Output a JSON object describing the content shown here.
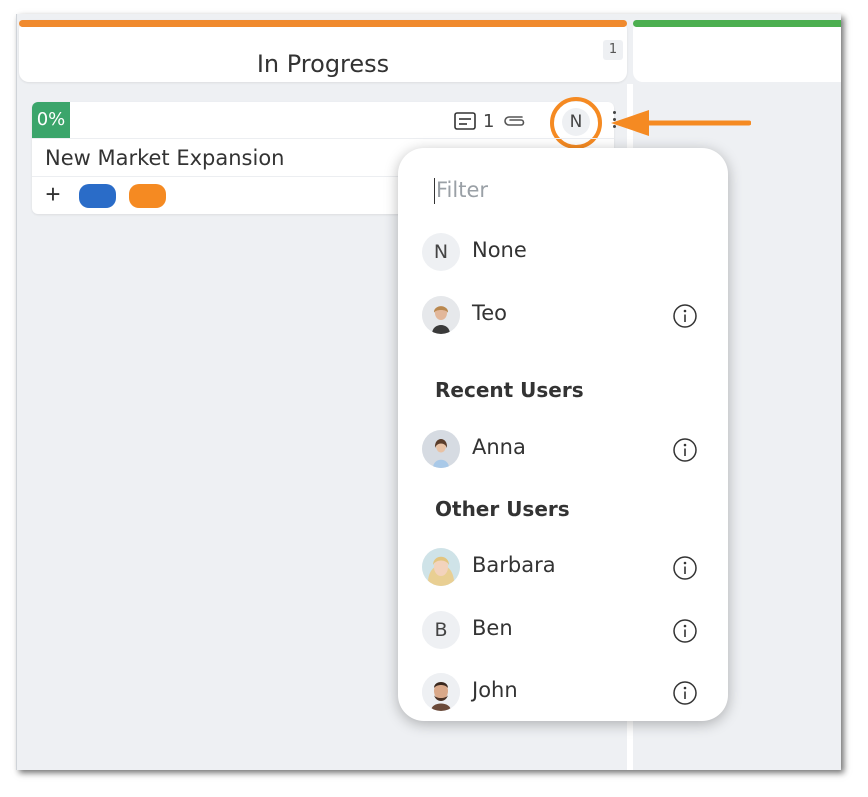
{
  "board": {
    "columns": [
      {
        "title": "In Progress",
        "count": "1",
        "accent": "#f08a2e"
      },
      {
        "title": "",
        "accent": "#4caf50"
      }
    ]
  },
  "card": {
    "progress": "0%",
    "progress_color": "#3ba56b",
    "title": "New Market Expansion",
    "description_count": "1",
    "assignee_initial": "N",
    "add_label": "+",
    "tags": [
      {
        "color": "#2a6cc8"
      },
      {
        "color": "#f58a22"
      }
    ],
    "icons": [
      "description-icon",
      "paperclip-icon",
      "kebab-menu-icon"
    ]
  },
  "highlight_color": "#f58a22",
  "assignee_menu": {
    "filter_placeholder": "Filter",
    "top_items": [
      {
        "name": "None",
        "initial": "N",
        "avatar": "initial",
        "info": false
      },
      {
        "name": "Teo",
        "avatar": "photo",
        "info": true
      }
    ],
    "recent_heading": "Recent Users",
    "recent_items": [
      {
        "name": "Anna",
        "avatar": "photo",
        "info": true
      }
    ],
    "other_heading": "Other Users",
    "other_items": [
      {
        "name": "Barbara",
        "avatar": "photo",
        "info": true
      },
      {
        "name": "Ben",
        "initial": "B",
        "avatar": "initial",
        "info": true
      },
      {
        "name": "John",
        "avatar": "photo",
        "info": true
      }
    ]
  }
}
